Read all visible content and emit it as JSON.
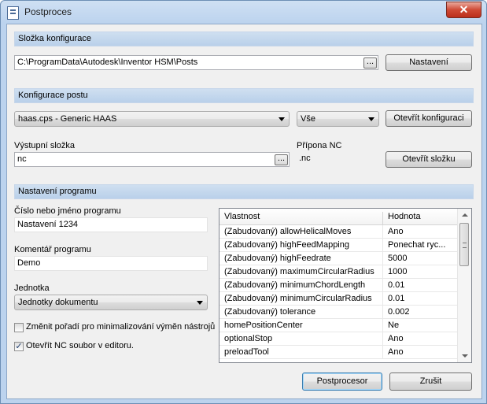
{
  "window": {
    "title": "Postproces",
    "close_glyph": "✕"
  },
  "config_folder": {
    "header": "Složka konfigurace",
    "path": "C:\\ProgramData\\Autodesk\\Inventor HSM\\Posts",
    "browse_glyph": "...",
    "settings_button": "Nastavení"
  },
  "post_config": {
    "header": "Konfigurace postu",
    "post_selected": "haas.cps - Generic HAAS",
    "filter_selected": "Vše",
    "open_config_button": "Otevřít konfiguraci",
    "output_folder_label": "Výstupní složka",
    "output_folder_value": "nc",
    "nc_extension_label": "Přípona NC",
    "nc_extension_value": ".nc",
    "open_folder_button": "Otevřít složku"
  },
  "program": {
    "header": "Nastavení programu",
    "program_name_label": "Číslo nebo jméno programu",
    "program_name_value": "Nastavení 1234",
    "comment_label": "Komentář programu",
    "comment_value": "Demo",
    "unit_label": "Jednotka",
    "unit_selected": "Jednotky dokumentu",
    "reorder_checkbox_label": "Změnit pořadí pro minimalizování výměn nástrojů",
    "reorder_checked": false,
    "open_nc_checkbox_label": "Otevřít NC soubor v editoru.",
    "open_nc_checked": true,
    "check_glyph": "✓"
  },
  "properties": {
    "columns": [
      "Vlastnost",
      "Hodnota"
    ],
    "rows": [
      [
        "(Zabudovaný) allowHelicalMoves",
        "Ano"
      ],
      [
        "(Zabudovaný) highFeedMapping",
        "Ponechat ryc..."
      ],
      [
        "(Zabudovaný) highFeedrate",
        "5000"
      ],
      [
        "(Zabudovaný) maximumCircularRadius",
        "1000"
      ],
      [
        "(Zabudovaný) minimumChordLength",
        "0.01"
      ],
      [
        "(Zabudovaný) minimumCircularRadius",
        "0.01"
      ],
      [
        "(Zabudovaný) tolerance",
        "0.002"
      ],
      [
        "homePositionCenter",
        "Ne"
      ],
      [
        "optionalStop",
        "Ano"
      ],
      [
        "preloadTool",
        "Ano"
      ]
    ]
  },
  "actions": {
    "postprocess_button": "Postprocesor",
    "cancel_button": "Zrušit"
  }
}
